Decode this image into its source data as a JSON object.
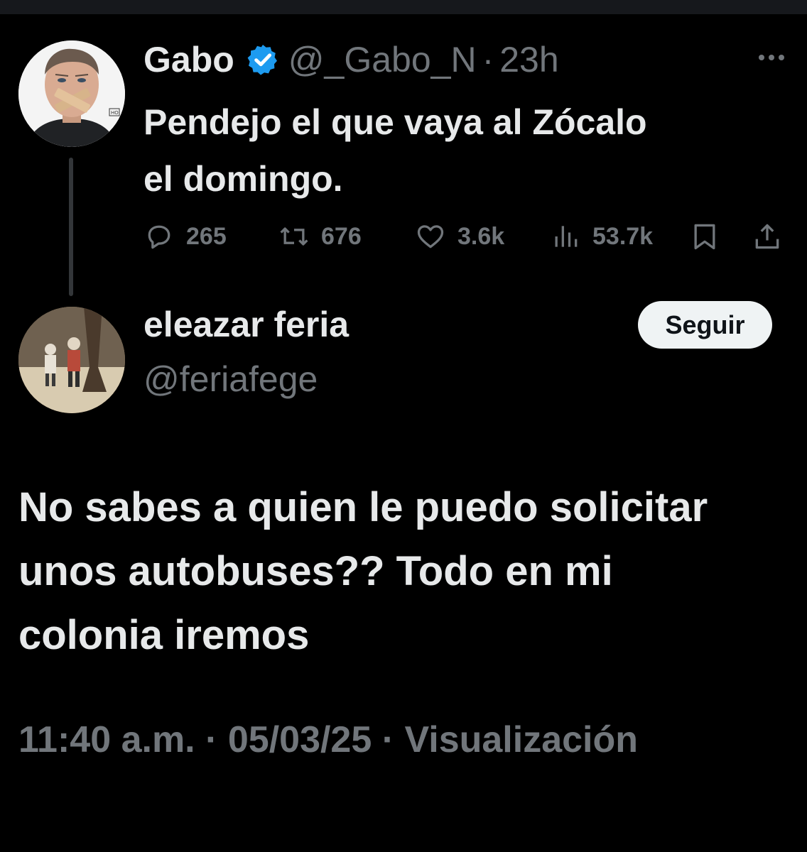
{
  "colors": {
    "background": "#000000",
    "text_primary": "#e7e9ea",
    "text_secondary": "#71767b",
    "verified_blue": "#1d9bf0",
    "thread_line": "#333639",
    "follow_button_bg": "#eff3f4"
  },
  "tweet": {
    "author": {
      "display_name": "Gabo",
      "verified": true,
      "handle": "@_Gabo_N",
      "avatar_icon": "avatar-image"
    },
    "separator": "·",
    "time_ago": "23h",
    "more_icon": "more-horizontal-icon",
    "text_line1": "Pendejo el que vaya al Zócalo",
    "text_line2": "el domingo.",
    "actions": {
      "reply_count": "265",
      "retweet_count": "676",
      "like_count": "3.6k",
      "views_count": "53.7k",
      "reply_icon": "reply-icon",
      "retweet_icon": "retweet-icon",
      "like_icon": "heart-icon",
      "views_icon": "views-icon",
      "bookmark_icon": "bookmark-icon",
      "share_icon": "share-icon"
    }
  },
  "reply": {
    "author": {
      "display_name": "eleazar feria",
      "handle": "@feriafege",
      "avatar_icon": "avatar-image"
    },
    "follow_label": "Seguir",
    "text_line1": "No sabes a quien le puedo solicitar",
    "text_line2": "unos autobuses?? Todo en mi",
    "text_line3": "colonia iremos",
    "time": "11:40 a.m.",
    "date": "05/03/25",
    "views_label": "Visualización",
    "separator": "·"
  }
}
